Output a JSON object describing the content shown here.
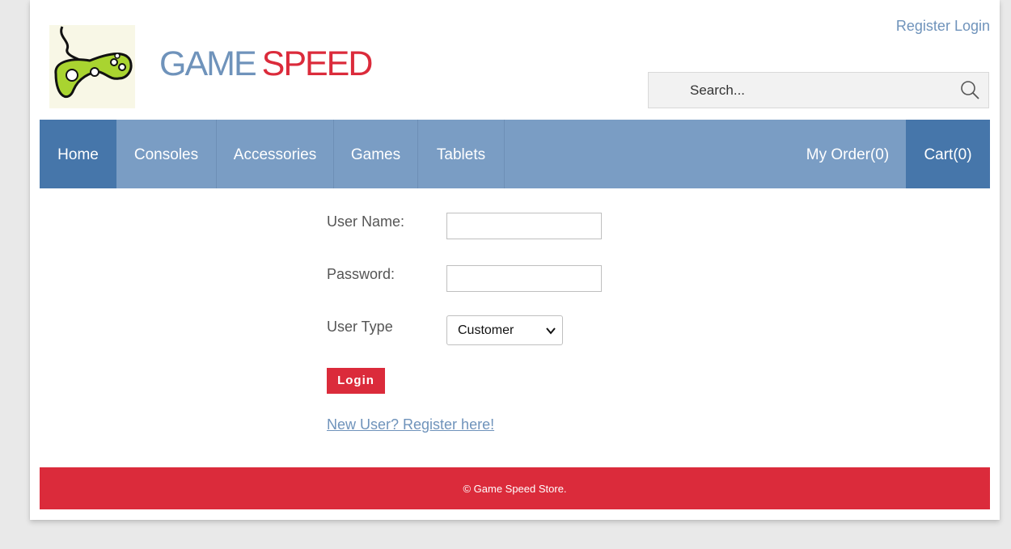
{
  "header": {
    "logo": {
      "word1": "GAME",
      "word2": "SPEED"
    },
    "auth": {
      "register": "Register",
      "login": "Login"
    },
    "search": {
      "placeholder": "Search..."
    }
  },
  "nav": {
    "items": [
      "Home",
      "Consoles",
      "Accessories",
      "Games",
      "Tablets"
    ],
    "my_order": "My Order(0)",
    "cart": "Cart(0)"
  },
  "form": {
    "username_label": "User Name:",
    "password_label": "Password:",
    "usertype_label": "User Type",
    "usertype_value": "Customer",
    "login_button": "Login",
    "register_link": "New User? Register here!"
  },
  "footer": {
    "text": "© Game Speed Store."
  },
  "colors": {
    "accent": "#db2b3b",
    "nav": "#7a9dc4",
    "nav_active": "#4676aa",
    "link": "#6f93bb"
  },
  "icons": {
    "search": "search-icon",
    "chevron": "chevron-down-icon",
    "logo": "game-controller-icon"
  }
}
